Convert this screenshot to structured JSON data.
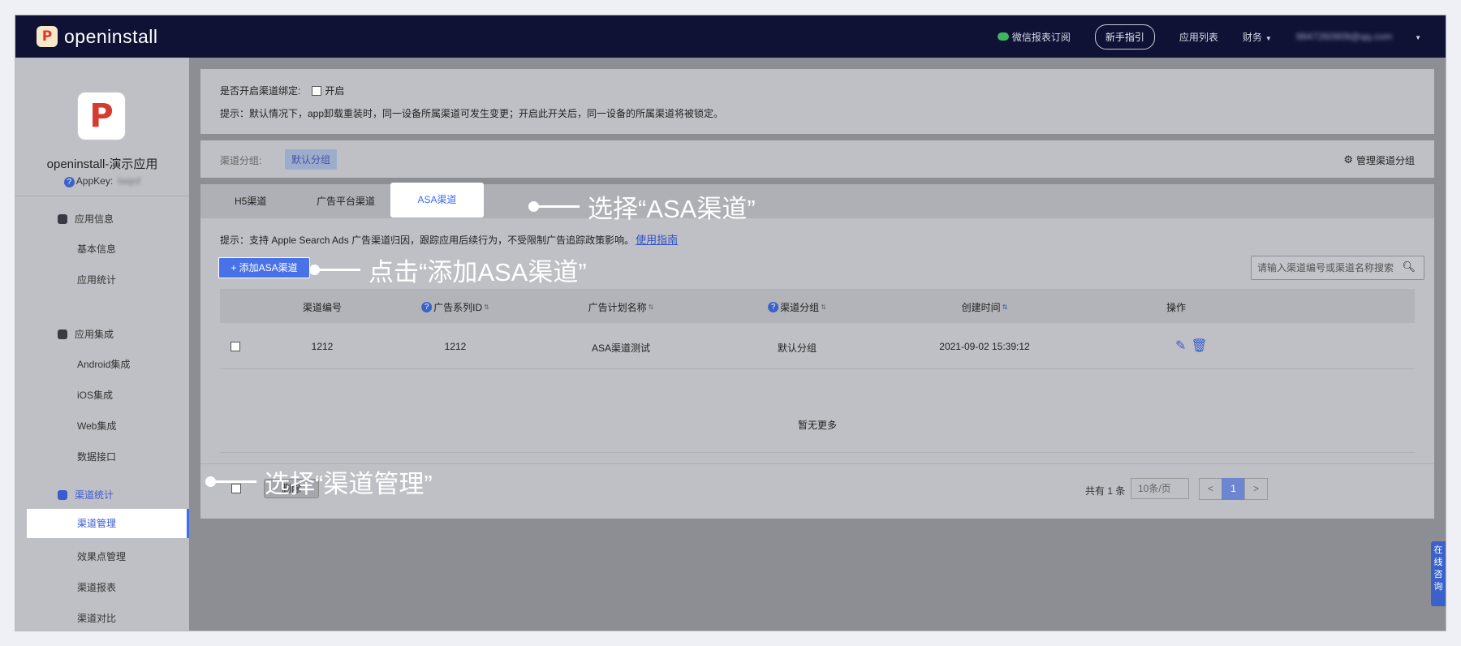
{
  "topbar": {
    "logo_mark": "P",
    "logo_text": "openinstall",
    "wechat_label": "微信报表订阅",
    "guide_label": "新手指引",
    "apps_label": "应用列表",
    "finance_label": "财务",
    "email": "9847260909@qq.com"
  },
  "sidebar": {
    "app_icon_letter": "P",
    "app_name": "openinstall-演示应用",
    "appkey_label": "AppKey:",
    "appkey_value": "lwqnf",
    "sections": [
      {
        "label": "应用信息",
        "items": [
          "基本信息",
          "应用统计"
        ]
      },
      {
        "label": "应用集成",
        "items": [
          "Android集成",
          "iOS集成",
          "Web集成",
          "数据接口"
        ]
      },
      {
        "label": "渠道统计",
        "items": [
          "渠道管理",
          "效果点管理",
          "渠道报表",
          "渠道对比"
        ]
      }
    ]
  },
  "binding": {
    "question": "是否开启渠道绑定:",
    "enable_label": "开启",
    "hint": "提示：默认情况下，app卸载重装时，同一设备所属渠道可发生变更；开启此开关后，同一设备的所属渠道将被锁定。"
  },
  "group": {
    "label": "渠道分组:",
    "tag": "默认分组",
    "manage_label": "管理渠道分组"
  },
  "tabs": [
    "H5渠道",
    "广告平台渠道",
    "ASA渠道"
  ],
  "asa": {
    "hint": "提示：支持 Apple Search Ads 广告渠道归因，跟踪应用后续行为，不受限制广告追踪政策影响。",
    "hint_link": "使用指南",
    "add_button": "+ 添加ASA渠道",
    "search_placeholder": "请输入渠道编号或渠道名称搜索"
  },
  "table": {
    "columns": [
      "渠道编号",
      "广告系列ID",
      "广告计划名称",
      "渠道分组",
      "创建时间",
      "操作"
    ],
    "rows": [
      {
        "id": "1212",
        "campaign_id": "1212",
        "plan_name": "ASA渠道测试",
        "group": "默认分组",
        "created": "2021-09-02 15:39:12"
      }
    ],
    "no_more": "暂无更多"
  },
  "footer": {
    "delete_label": "删除",
    "total": "共有 1 条",
    "page_size": "10条/页",
    "prev": "<",
    "page": "1",
    "next": ">"
  },
  "help_widget": "在线咨询",
  "annotations": {
    "tab": "选择“ASA渠道”",
    "add": "点击“添加ASA渠道”",
    "menu": "选择“渠道管理”"
  }
}
